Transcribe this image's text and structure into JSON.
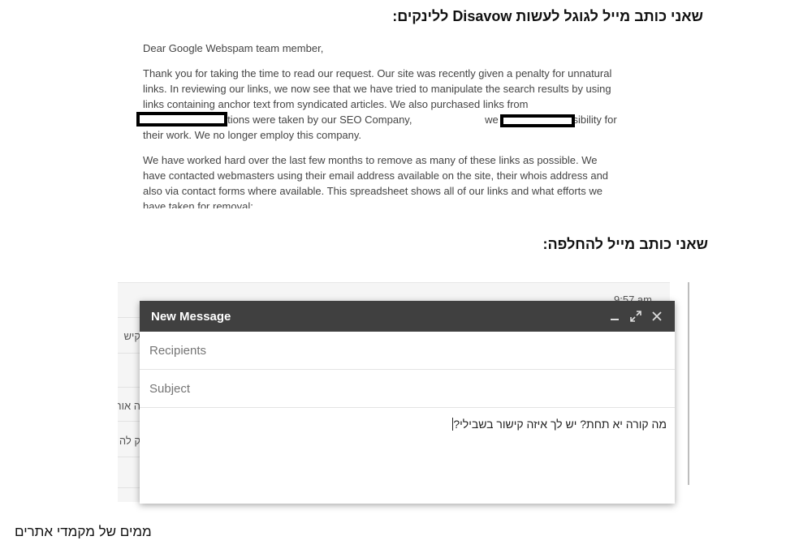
{
  "headings": {
    "disavow": "שאני כותב מייל לגוגל לעשות Disavow ללינקים:",
    "swap": "שאני כותב מייל להחלפה:",
    "footer": "ממים של מקמדי אתרים"
  },
  "letter": {
    "greeting": "Dear Google Webspam team member,",
    "p1_a": "Thank you for taking the time to read our request. Our site was recently given a penalty for unnatural links. In reviewing our links, we now see that we have tried to manipulate the search results by using links containing anchor text from syndicated articles. We also purchased links from",
    "p1_b": "Although these actions were taken by our SEO Company,",
    "p1_c": "we take full responsibility for their work. We no longer employ this company.",
    "p2": "We have worked hard over the last few months to remove as many of these links as possible. We have contacted webmasters using their email address available on the site, their whois address and also via contact forms where available. This spreadsheet shows all of our links and what efforts we have taken for removal:"
  },
  "gmail_bg": {
    "time": "9:57 am",
    "snippets": [
      "קיש",
      "ה אור",
      "ק לה"
    ]
  },
  "compose": {
    "title": "New Message",
    "icons": [
      "minimize-icon",
      "expand-icon",
      "close-icon"
    ],
    "recipients_placeholder": "Recipients",
    "subject_placeholder": "Subject",
    "body": "מה קורה יא תחת? יש לך איזה קישור בשבילי?"
  }
}
